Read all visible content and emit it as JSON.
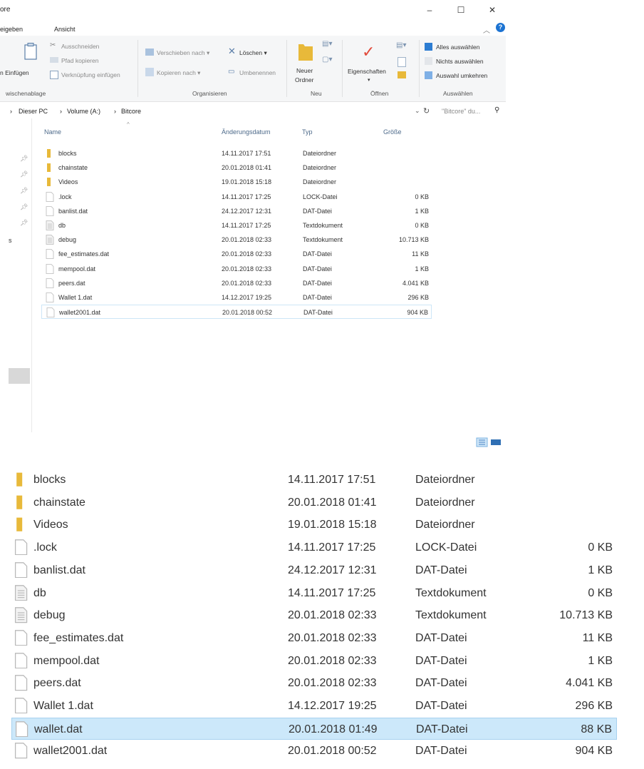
{
  "window": {
    "title_partial": "ore",
    "controls": [
      "–",
      "☐",
      "✕"
    ]
  },
  "menu": [
    "eigeben",
    "Ansicht"
  ],
  "ribbon": {
    "clipboard": {
      "einfuegen": "n Einfügen",
      "ausschneiden": "Ausschneiden",
      "pfad_kopieren": "Pfad kopieren",
      "verknuepfung": "Verknüpfung einfügen",
      "group_label": "wischenablage"
    },
    "organize": {
      "verschieben": "Verschieben nach ▾",
      "kopieren": "Kopieren nach ▾",
      "loeschen": "Löschen ▾",
      "umbenennen": "Umbenennen",
      "group_label": "Organisieren"
    },
    "new": {
      "neuer_ordner_1": "Neuer",
      "neuer_ordner_2": "Ordner",
      "group_label": "Neu"
    },
    "open": {
      "eigenschaften": "Eigenschaften",
      "group_label": "Öffnen"
    },
    "select": {
      "alle": "Alles auswählen",
      "nichts": "Nichts auswählen",
      "umkehren": "Auswahl umkehren",
      "group_label": "Auswählen"
    }
  },
  "address": {
    "crumbs": [
      "Dieser PC",
      "Volume (A:)",
      "Bitcore"
    ],
    "search_placeholder": "\"Bitcore\" du..."
  },
  "columns": {
    "name": "Name",
    "date": "Änderungsdatum",
    "type": "Typ",
    "size": "Größe"
  },
  "nav_stub": "s",
  "files_top": [
    {
      "name": "blocks",
      "date": "14.11.2017 17:51",
      "type": "Dateiordner",
      "size": "",
      "icon": "folder"
    },
    {
      "name": "chainstate",
      "date": "20.01.2018 01:41",
      "type": "Dateiordner",
      "size": "",
      "icon": "folder"
    },
    {
      "name": "Videos",
      "date": "19.01.2018 15:18",
      "type": "Dateiordner",
      "size": "",
      "icon": "folder"
    },
    {
      "name": ".lock",
      "date": "14.11.2017 17:25",
      "type": "LOCK-Datei",
      "size": "0 KB",
      "icon": "file"
    },
    {
      "name": "banlist.dat",
      "date": "24.12.2017 12:31",
      "type": "DAT-Datei",
      "size": "1 KB",
      "icon": "file"
    },
    {
      "name": "db",
      "date": "14.11.2017 17:25",
      "type": "Textdokument",
      "size": "0 KB",
      "icon": "text"
    },
    {
      "name": "debug",
      "date": "20.01.2018 02:33",
      "type": "Textdokument",
      "size": "10.713 KB",
      "icon": "text"
    },
    {
      "name": "fee_estimates.dat",
      "date": "20.01.2018 02:33",
      "type": "DAT-Datei",
      "size": "11 KB",
      "icon": "file"
    },
    {
      "name": "mempool.dat",
      "date": "20.01.2018 02:33",
      "type": "DAT-Datei",
      "size": "1 KB",
      "icon": "file"
    },
    {
      "name": "peers.dat",
      "date": "20.01.2018 02:33",
      "type": "DAT-Datei",
      "size": "4.041 KB",
      "icon": "file"
    },
    {
      "name": "Wallet 1.dat",
      "date": "14.12.2017 19:25",
      "type": "DAT-Datei",
      "size": "296 KB",
      "icon": "file"
    },
    {
      "name": "wallet2001.dat",
      "date": "20.01.2018 00:52",
      "type": "DAT-Datei",
      "size": "904 KB",
      "icon": "file"
    }
  ],
  "files_bottom": [
    {
      "name": "blocks",
      "date": "14.11.2017 17:51",
      "type": "Dateiordner",
      "size": "",
      "icon": "folder"
    },
    {
      "name": "chainstate",
      "date": "20.01.2018 01:41",
      "type": "Dateiordner",
      "size": "",
      "icon": "folder"
    },
    {
      "name": "Videos",
      "date": "19.01.2018 15:18",
      "type": "Dateiordner",
      "size": "",
      "icon": "folder"
    },
    {
      "name": ".lock",
      "date": "14.11.2017 17:25",
      "type": "LOCK-Datei",
      "size": "0 KB",
      "icon": "file"
    },
    {
      "name": "banlist.dat",
      "date": "24.12.2017 12:31",
      "type": "DAT-Datei",
      "size": "1 KB",
      "icon": "file"
    },
    {
      "name": "db",
      "date": "14.11.2017 17:25",
      "type": "Textdokument",
      "size": "0 KB",
      "icon": "text"
    },
    {
      "name": "debug",
      "date": "20.01.2018 02:33",
      "type": "Textdokument",
      "size": "10.713 KB",
      "icon": "text"
    },
    {
      "name": "fee_estimates.dat",
      "date": "20.01.2018 02:33",
      "type": "DAT-Datei",
      "size": "11 KB",
      "icon": "file"
    },
    {
      "name": "mempool.dat",
      "date": "20.01.2018 02:33",
      "type": "DAT-Datei",
      "size": "1 KB",
      "icon": "file"
    },
    {
      "name": "peers.dat",
      "date": "20.01.2018 02:33",
      "type": "DAT-Datei",
      "size": "4.041 KB",
      "icon": "file"
    },
    {
      "name": "Wallet 1.dat",
      "date": "14.12.2017 19:25",
      "type": "DAT-Datei",
      "size": "296 KB",
      "icon": "file"
    },
    {
      "name": "wallet.dat",
      "date": "20.01.2018 01:49",
      "type": "DAT-Datei",
      "size": "88 KB",
      "icon": "file"
    },
    {
      "name": "wallet2001.dat",
      "date": "20.01.2018 00:52",
      "type": "DAT-Datei",
      "size": "904 KB",
      "icon": "file"
    }
  ],
  "colors": {
    "folder": "#e8b93a",
    "selection_bg": "#cce8fa",
    "selection_border": "#a7d1ef",
    "help_blue": "#1c73d2"
  }
}
